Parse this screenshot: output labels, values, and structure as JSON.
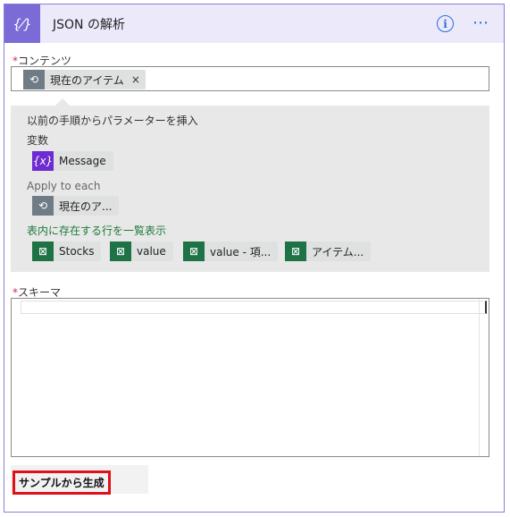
{
  "header": {
    "icon_glyph": "{⁄}",
    "title": "JSON の解析",
    "info_glyph": "i",
    "more_glyph": "⋯"
  },
  "content_field": {
    "required_mark": "*",
    "label": "コンテンツ",
    "token": {
      "label": "現在のアイテム",
      "close": "×",
      "icon": "loop-icon"
    }
  },
  "popup": {
    "heading": "以前の手順からパラメーターを挿入",
    "sections": [
      {
        "title": "変数",
        "tokens": [
          {
            "label": "Message",
            "icon": "variable-icon",
            "icon_glyph": "{x}"
          }
        ]
      },
      {
        "title": "Apply to each",
        "tokens": [
          {
            "label": "現在のア...",
            "icon": "loop-icon"
          }
        ]
      },
      {
        "title": "表内に存在する行を一覧表示",
        "tokens": [
          {
            "label": "Stocks",
            "icon": "excel-icon"
          },
          {
            "label": "value",
            "icon": "excel-icon"
          },
          {
            "label": "value - 項...",
            "icon": "excel-icon"
          },
          {
            "label": "アイテム...",
            "icon": "excel-icon"
          }
        ]
      }
    ]
  },
  "schema_field": {
    "required_mark": "*",
    "label": "スキーマ",
    "value": ""
  },
  "generate_button": {
    "label": "サンプルから生成"
  },
  "colors": {
    "accent": "#7a6bd6",
    "header_bg": "#ece9fb",
    "link_blue": "#2b6fd6",
    "excel_green": "#1f7246",
    "variable_purple": "#6d2bd1",
    "highlight_red": "#e0101a"
  }
}
